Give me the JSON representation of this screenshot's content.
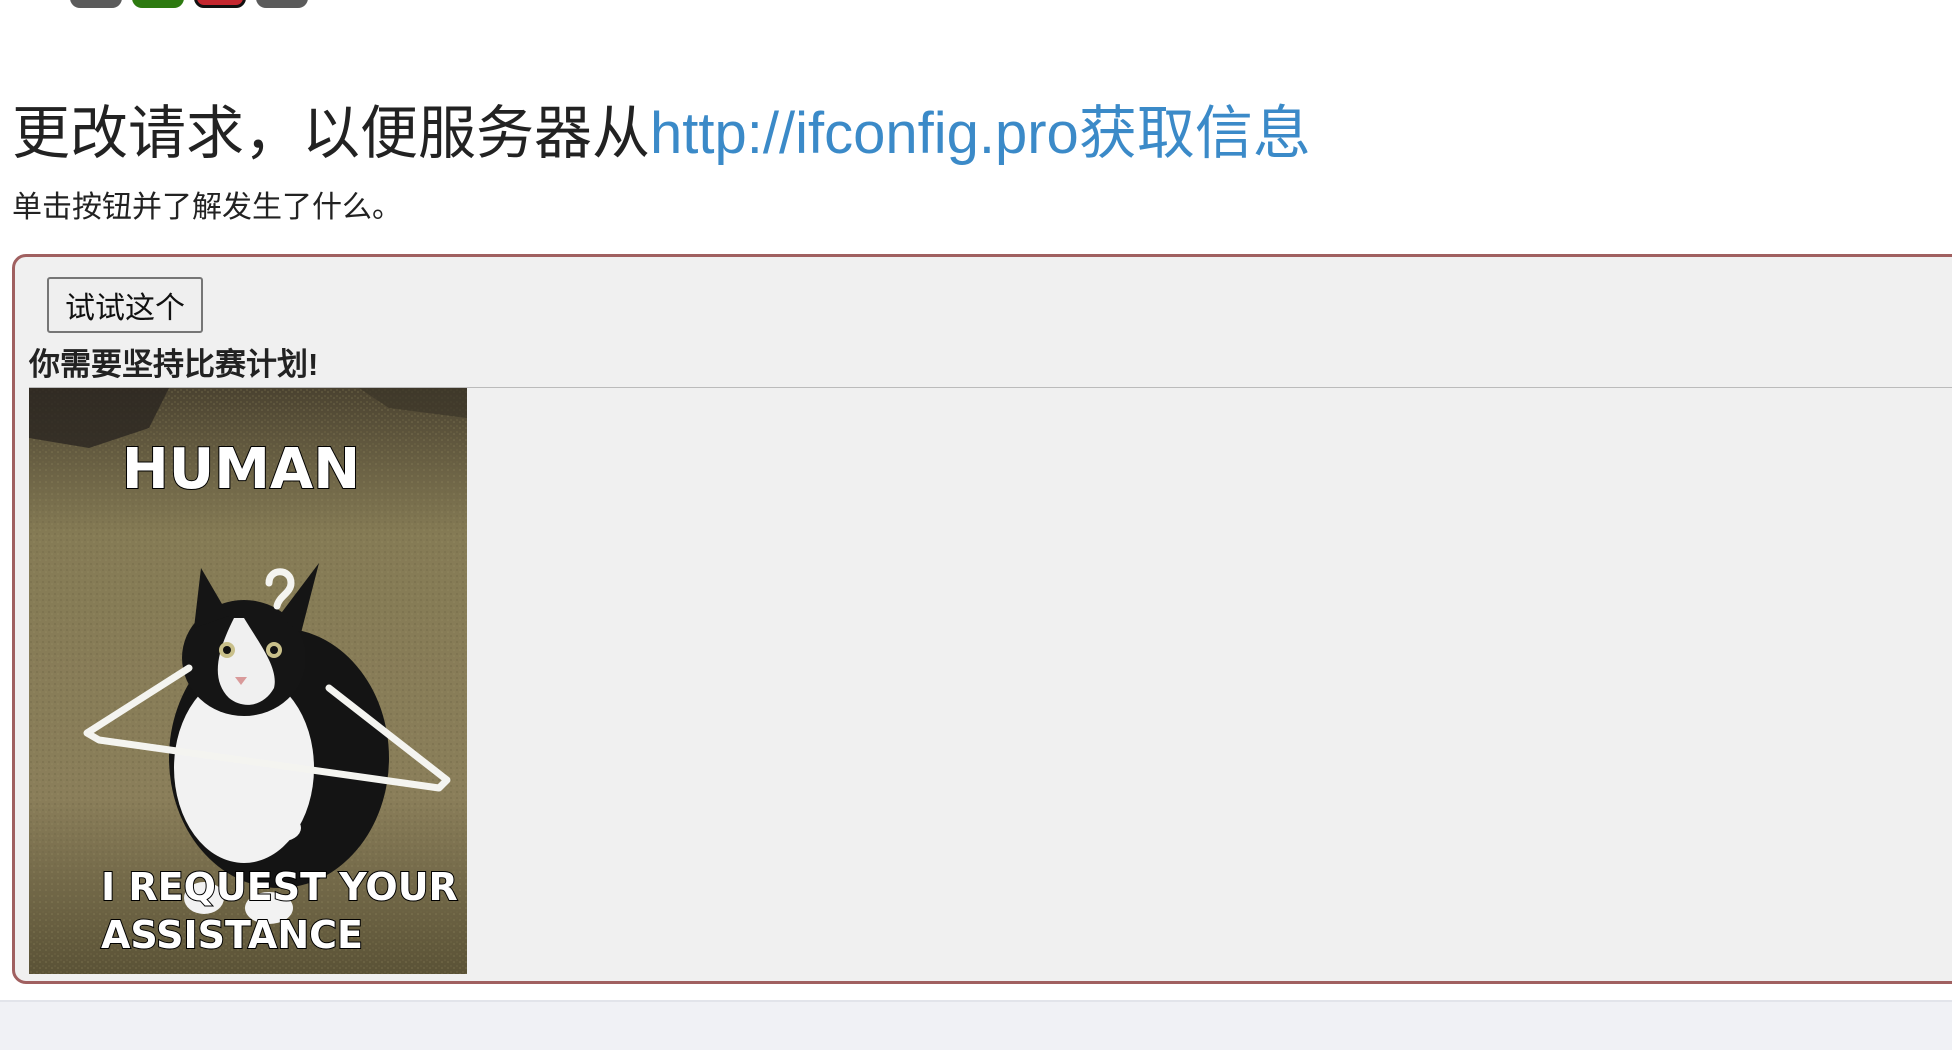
{
  "heading": {
    "text": "更改请求，以便服务器从",
    "link_text": "http://ifconfig.pro获取信息"
  },
  "subtext": "单击按钮并了解发生了什么。",
  "demo": {
    "button_label": "试试这个",
    "result_text": "你需要坚持比赛计划!",
    "image": {
      "top_caption": "HUMAN",
      "bottom_caption_line1": "I REQUEST YOUR",
      "bottom_caption_line2": "ASSISTANCE"
    }
  },
  "colors": {
    "link": "#3b8ac8",
    "frame_border": "#a06060",
    "frame_background": "#f0f0f0"
  }
}
